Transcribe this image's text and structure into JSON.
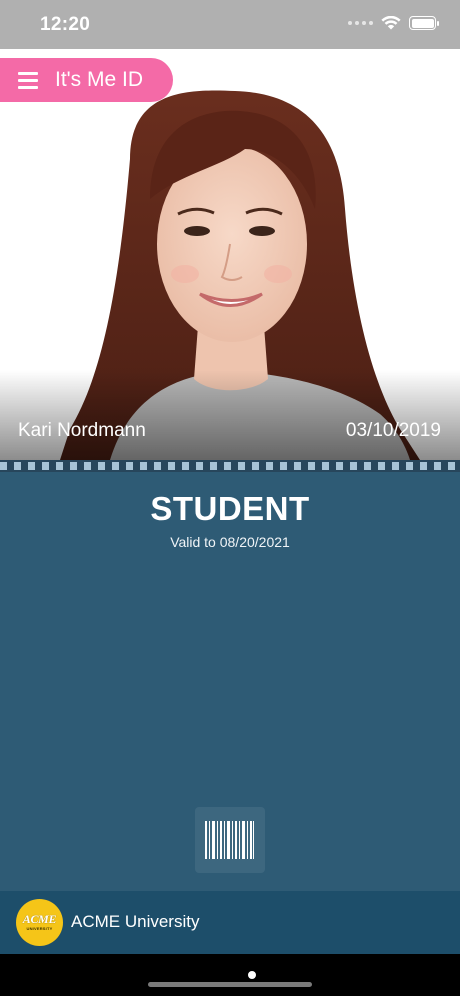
{
  "status_bar": {
    "time": "12:20",
    "icons": [
      "signal-dots-icon",
      "wifi-icon",
      "battery-icon"
    ]
  },
  "header": {
    "app_title": "It's Me ID",
    "menu_icon": "hamburger-menu-icon",
    "accent_color": "#f46aa7"
  },
  "card": {
    "holder_name": "Kari Nordmann",
    "issue_date": "03/10/2019",
    "role": "STUDENT",
    "valid_text": "Valid to 08/20/2021",
    "barcode_icon": "barcode-icon",
    "card_color": "#2e5b75"
  },
  "footer": {
    "institution_name": "ACME University",
    "logo_text": "ACME",
    "logo_subtext": "UNIVERSITY",
    "footer_color": "#1d4e6a"
  }
}
